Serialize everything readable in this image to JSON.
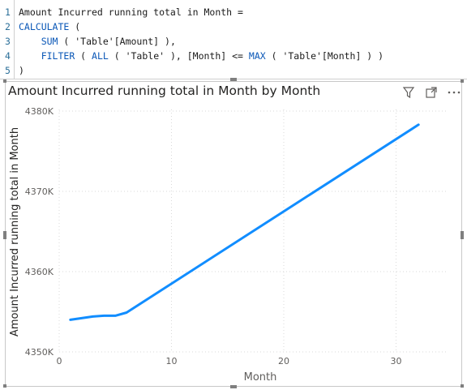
{
  "editor": {
    "lines": [
      {
        "num": "1",
        "parts": [
          {
            "t": "Amount Incurred running total in Month =",
            "c": ""
          }
        ]
      },
      {
        "num": "2",
        "parts": [
          {
            "t": "CALCULATE",
            "c": "kw"
          },
          {
            "t": " (",
            "c": ""
          }
        ]
      },
      {
        "num": "3",
        "parts": [
          {
            "t": "    ",
            "c": ""
          },
          {
            "t": "SUM",
            "c": "kw"
          },
          {
            "t": " ( 'Table'[Amount] ),",
            "c": ""
          }
        ]
      },
      {
        "num": "4",
        "parts": [
          {
            "t": "    ",
            "c": ""
          },
          {
            "t": "FILTER",
            "c": "kw"
          },
          {
            "t": " ( ",
            "c": ""
          },
          {
            "t": "ALL",
            "c": "kw"
          },
          {
            "t": " ( 'Table' ), [Month] <= ",
            "c": ""
          },
          {
            "t": "MAX",
            "c": "kw"
          },
          {
            "t": " ( 'Table'[Month] ) )",
            "c": ""
          }
        ]
      },
      {
        "num": "5",
        "parts": [
          {
            "t": ")",
            "c": ""
          }
        ]
      }
    ]
  },
  "visual": {
    "title": "Amount Incurred running total in Month by Month",
    "icons": [
      "filter-icon",
      "focus-mode-icon",
      "more-options-icon"
    ]
  },
  "chart_data": {
    "type": "line",
    "title": "Amount Incurred running total in Month by Month",
    "xlabel": "Month",
    "ylabel": "Amount Incurred running total in Month",
    "xlim": [
      0,
      33
    ],
    "ylim": [
      4350,
      4380
    ],
    "xticks": [
      0,
      10,
      20,
      30
    ],
    "yticks": [
      4350,
      4360,
      4370,
      4380
    ],
    "ytick_labels": [
      "4350K",
      "4360K",
      "4370K",
      "4380K"
    ],
    "grid": true,
    "color": "#118DFF",
    "series": [
      {
        "x": [
          1,
          2,
          3,
          4,
          5,
          6,
          32
        ],
        "values": [
          4354.0,
          4354.2,
          4354.4,
          4354.5,
          4354.5,
          4354.9,
          4378.3
        ]
      }
    ]
  }
}
